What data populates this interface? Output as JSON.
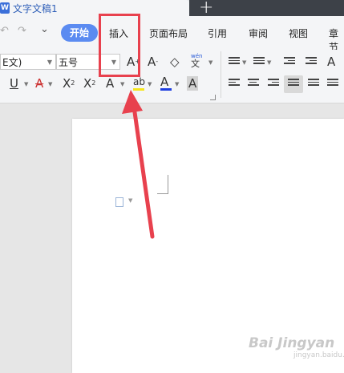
{
  "window": {
    "doc_title": "文字文稿1",
    "app_icon": "W",
    "new_tab_label": "+"
  },
  "quick_access": {
    "undo_icon": "↶",
    "redo_icon": "↷",
    "more_icon": "⌄"
  },
  "menu": {
    "start": "开始",
    "items": [
      "插入",
      "页面布局",
      "引用",
      "审阅",
      "视图",
      "章节"
    ]
  },
  "toolbar": {
    "font_name": "E文)",
    "font_size": "五号",
    "grow_font": "A",
    "grow_sup": "+",
    "shrink_font": "A",
    "shrink_sup": "-",
    "clear_format": "◇",
    "pinyin_top": "wén",
    "pinyin": "文",
    "underline": "U",
    "strike": "A",
    "superscript": "X",
    "superscript_mark": "2",
    "subscript": "X",
    "subscript_mark": "2",
    "text_effect": "A",
    "highlight": "ab",
    "font_color": "A",
    "char_shading": "A",
    "text_direction": "A"
  },
  "colors": {
    "accent_button": "#5b8bf1",
    "annotation_red": "#e8414e",
    "highlight_yellow": "#f5e51b",
    "font_color_blue": "#1f3fe0"
  },
  "watermark": {
    "main": "Bai Jingyan",
    "sub": "jingyan.baidu.com"
  }
}
